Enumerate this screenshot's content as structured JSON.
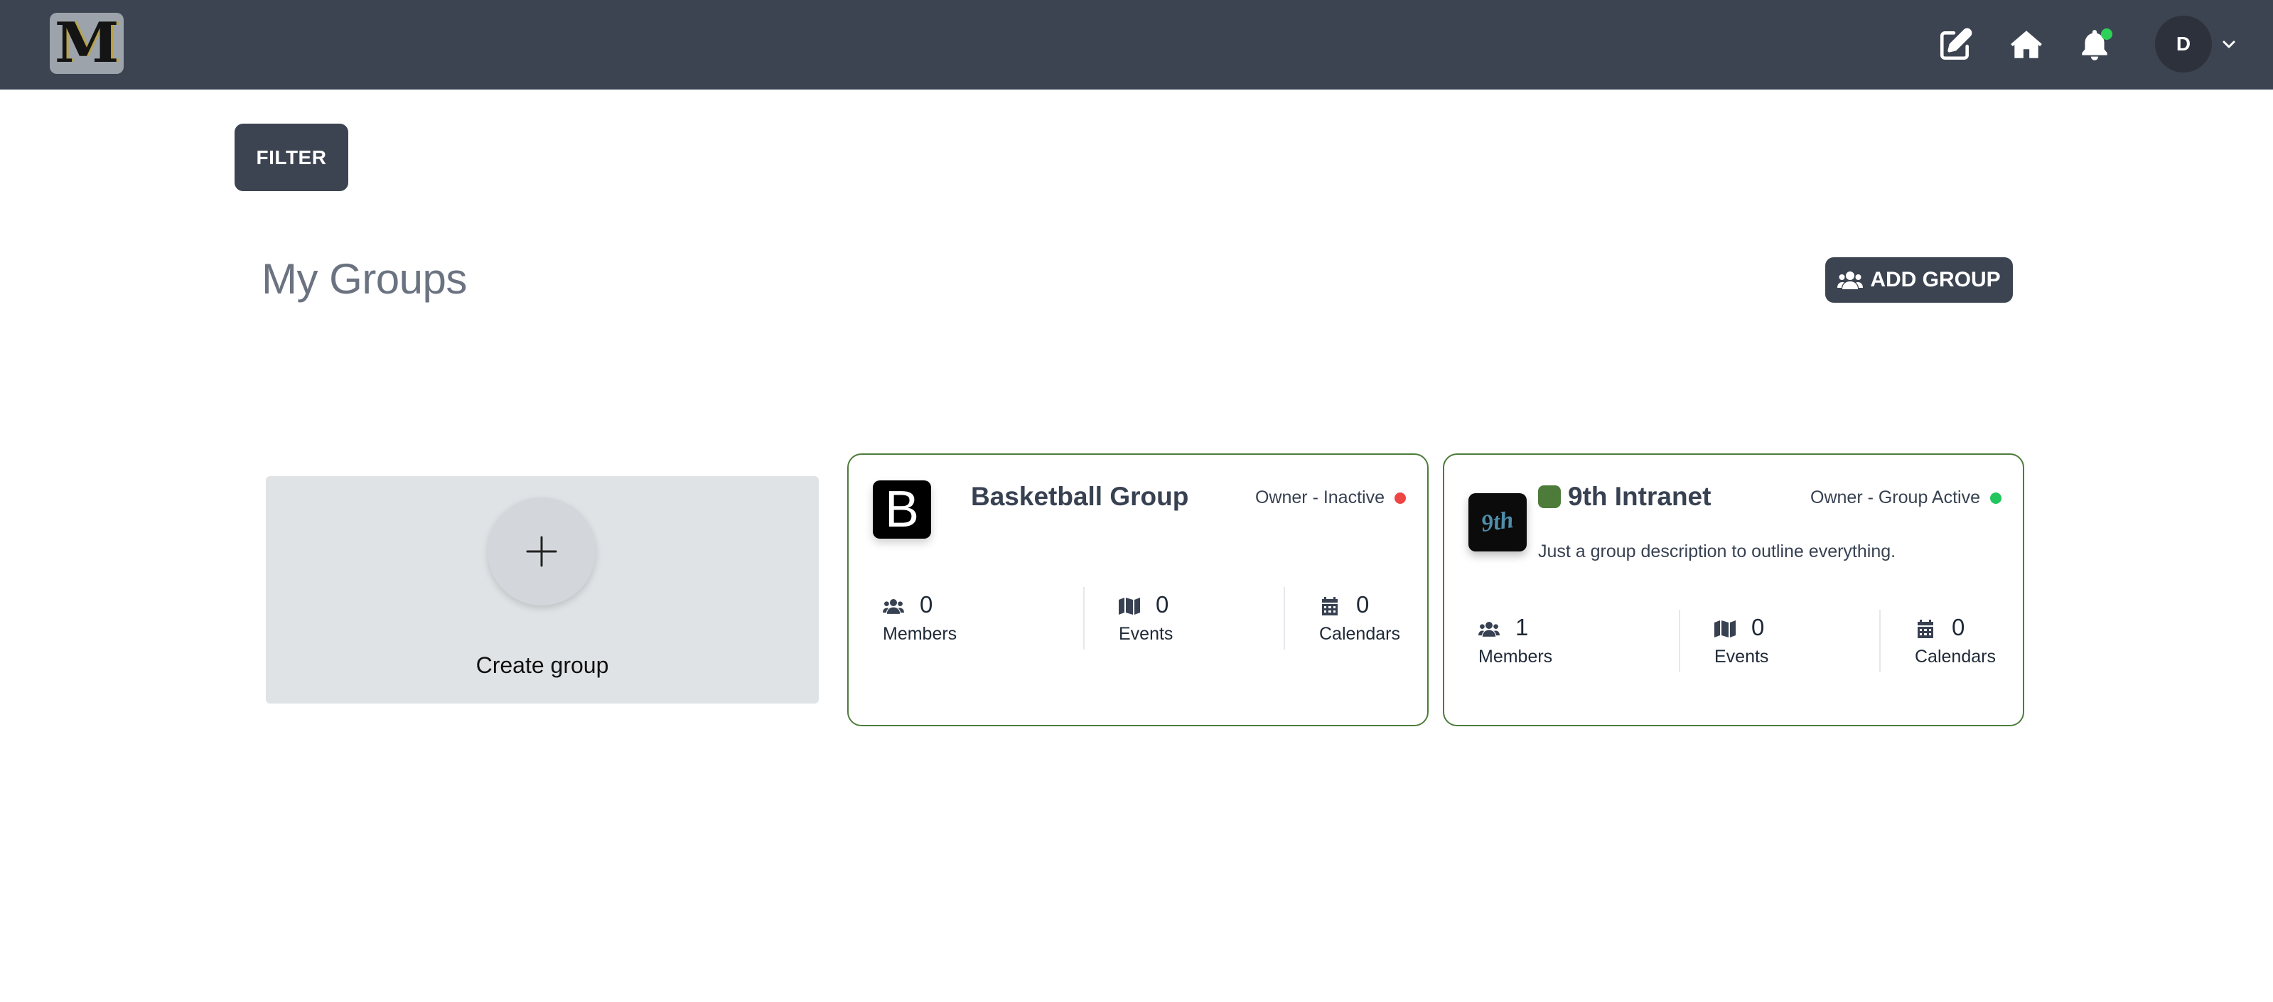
{
  "topbar": {
    "logo_letter": "M",
    "icons": [
      "edit-icon",
      "home-icon",
      "bell-icon"
    ],
    "avatar_initial": "D"
  },
  "filter": {
    "label": "FILTER"
  },
  "header": {
    "title": "My Groups",
    "add_group_label": "ADD GROUP"
  },
  "create_card": {
    "label": "Create group"
  },
  "groups": [
    {
      "name": "Basketball Group",
      "logo_letter": "B",
      "status": "Owner - Inactive",
      "status_color": "#ef4444",
      "description": "",
      "stats": [
        {
          "icon": "users-icon",
          "value": "0",
          "label": "Members"
        },
        {
          "icon": "map-icon",
          "value": "0",
          "label": "Events"
        },
        {
          "icon": "calendar-icon",
          "value": "0",
          "label": "Calendars"
        }
      ]
    },
    {
      "name": "9th Intranet",
      "logo_letter": "9th",
      "status": "Owner - Group Active",
      "status_color": "#22c55e",
      "description": "Just a group description to outline everything.",
      "stats": [
        {
          "icon": "users-icon",
          "value": "1",
          "label": "Members"
        },
        {
          "icon": "map-icon",
          "value": "0",
          "label": "Events"
        },
        {
          "icon": "calendar-icon",
          "value": "0",
          "label": "Calendars"
        }
      ]
    }
  ],
  "colors": {
    "topbar": "#3d4451",
    "accent_green": "#4d7c3a",
    "inactive": "#ef4444",
    "active": "#22c55e"
  }
}
